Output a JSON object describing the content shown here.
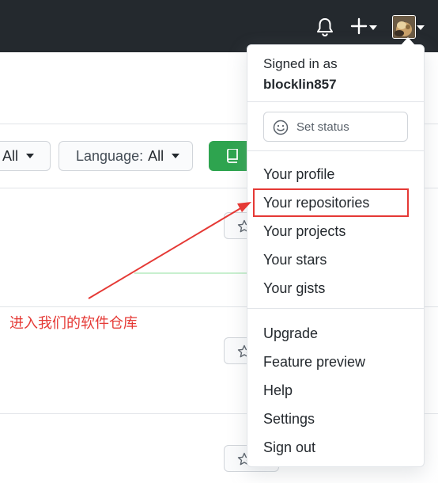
{
  "header": {
    "notifications_icon": "bell-icon",
    "create_icon": "plus-icon",
    "avatar_icon": "user-avatar"
  },
  "filters": {
    "type_value": "All",
    "language_label": "Language:",
    "language_value": "All",
    "new_icon": "repo-icon"
  },
  "dropdown": {
    "signed_in_label": "Signed in as",
    "username": "blocklin857",
    "set_status_label": "Set status",
    "items_top": [
      "Your profile",
      "Your repositories",
      "Your projects",
      "Your stars",
      "Your gists"
    ],
    "items_bottom": [
      "Upgrade",
      "Feature preview",
      "Help",
      "Settings",
      "Sign out"
    ]
  },
  "annotation": {
    "text": "进入我们的软件仓库",
    "color": "#e53935"
  },
  "colors": {
    "header_bg": "#24292e",
    "new_button": "#2ea44f",
    "highlight": "#e53935"
  }
}
